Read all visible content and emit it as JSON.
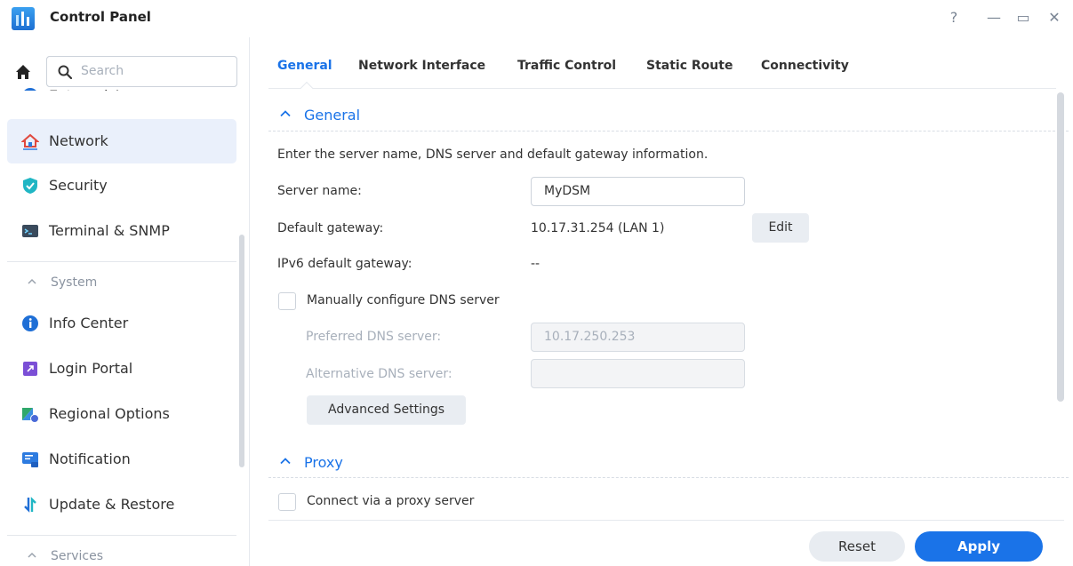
{
  "window": {
    "title": "Control Panel",
    "controls": {
      "help": "?",
      "minimize": "—",
      "maximize": "▭",
      "close": "✕"
    }
  },
  "sidebar": {
    "search_placeholder": "Search",
    "items": [
      {
        "label": "External Access",
        "icon": "external-access-icon"
      },
      {
        "label": "Network",
        "icon": "network-icon",
        "active": true
      },
      {
        "label": "Security",
        "icon": "security-shield-icon"
      },
      {
        "label": "Terminal & SNMP",
        "icon": "terminal-icon"
      }
    ],
    "section_system": "System",
    "system_items": [
      {
        "label": "Info Center",
        "icon": "info-center-icon"
      },
      {
        "label": "Login Portal",
        "icon": "login-portal-icon"
      },
      {
        "label": "Regional Options",
        "icon": "regional-options-icon"
      },
      {
        "label": "Notification",
        "icon": "notification-icon"
      },
      {
        "label": "Update & Restore",
        "icon": "update-restore-icon"
      }
    ],
    "section_services": "Services"
  },
  "tabs": [
    {
      "label": "General",
      "active": true
    },
    {
      "label": "Network Interface"
    },
    {
      "label": "Traffic Control"
    },
    {
      "label": "Static Route"
    },
    {
      "label": "Connectivity"
    }
  ],
  "general": {
    "section_title": "General",
    "description": "Enter the server name, DNS server and default gateway information.",
    "server_name_label": "Server name:",
    "server_name_value": "MyDSM",
    "default_gateway_label": "Default gateway:",
    "default_gateway_value": "10.17.31.254 (LAN 1)",
    "edit_label": "Edit",
    "ipv6_label": "IPv6 default gateway:",
    "ipv6_value": "--",
    "manual_dns_label": "Manually configure DNS server",
    "manual_dns_checked": false,
    "preferred_dns_label": "Preferred DNS server:",
    "preferred_dns_value": "10.17.250.253",
    "alternative_dns_label": "Alternative DNS server:",
    "alternative_dns_value": "",
    "advanced_label": "Advanced Settings"
  },
  "proxy": {
    "section_title": "Proxy",
    "connect_label": "Connect via a proxy server",
    "connect_checked": false
  },
  "footer": {
    "reset_label": "Reset",
    "apply_label": "Apply"
  },
  "colors": {
    "accent": "#1a73e8",
    "active_item_bg": "#eaf0fb"
  }
}
